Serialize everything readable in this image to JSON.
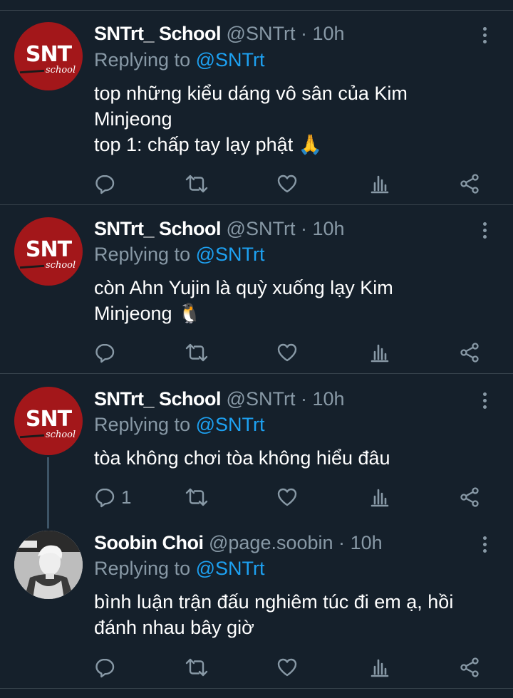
{
  "colors": {
    "background": "#15202b",
    "divider": "#38444d",
    "secondary": "#8899a6",
    "accent": "#1da1f2"
  },
  "tweets": [
    {
      "author": "SNTrt_ School",
      "handle": "@SNTrt",
      "dot": "·",
      "time": "10h",
      "replying_prefix": "Replying to",
      "replying_to": "@SNTrt",
      "avatar": {
        "text": "SNT",
        "subtext": "school"
      },
      "text_lines": [
        "top những kiểu dáng vô sân của Kim",
        "Minjeong",
        "top 1: chấp tay lạy phật 🙏"
      ],
      "reply_count": ""
    },
    {
      "author": "SNTrt_ School",
      "handle": "@SNTrt",
      "dot": "·",
      "time": "10h",
      "replying_prefix": "Replying to",
      "replying_to": "@SNTrt",
      "avatar": {
        "text": "SNT",
        "subtext": "school"
      },
      "text_lines": [
        "còn Ahn Yujin là quỳ xuống lạy Kim",
        "Minjeong 🐧"
      ],
      "reply_count": ""
    },
    {
      "author": "SNTrt_ School",
      "handle": "@SNTrt",
      "dot": "·",
      "time": "10h",
      "replying_prefix": "Replying to",
      "replying_to": "@SNTrt",
      "avatar": {
        "text": "SNT",
        "subtext": "school"
      },
      "text_lines": [
        "tòa không chơi tòa không hiểu đâu"
      ],
      "reply_count": "1"
    },
    {
      "author": "Soobin Choi",
      "handle": "@page.soobin",
      "dot": "·",
      "time": "10h",
      "replying_prefix": "Replying to",
      "replying_to": "@SNTrt",
      "avatar": {
        "text": "",
        "subtext": ""
      },
      "text_lines": [
        "bình luận trận đấu nghiêm túc đi em ạ, hồi",
        "đánh nhau bây giờ"
      ],
      "reply_count": ""
    }
  ]
}
